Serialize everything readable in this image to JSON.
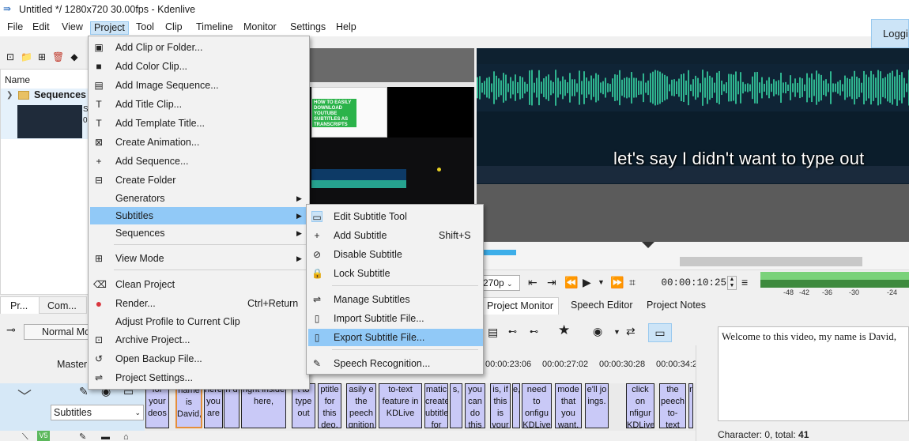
{
  "window": {
    "title": "Untitled */ 1280x720 30.00fps - Kdenlive"
  },
  "menubar": {
    "items": [
      "File",
      "Edit",
      "View",
      "Project",
      "Tool",
      "Clip",
      "Timeline",
      "Monitor",
      "Settings",
      "Help"
    ],
    "login_label": "Loggin"
  },
  "project_menu": {
    "items": [
      {
        "label": "Add Clip or Folder...",
        "icon": "add-clip-icon"
      },
      {
        "label": "Add Color Clip...",
        "icon": "color-clip-icon"
      },
      {
        "label": "Add Image Sequence...",
        "icon": "image-sequence-icon"
      },
      {
        "label": "Add Title Clip...",
        "icon": "title-clip-icon"
      },
      {
        "label": "Add Template Title...",
        "icon": "template-title-icon"
      },
      {
        "label": "Create Animation...",
        "icon": "animation-icon"
      },
      {
        "label": "Add Sequence...",
        "icon": "plus-icon"
      },
      {
        "label": "Create Folder",
        "icon": "folder-icon"
      },
      {
        "label": "Generators",
        "icon": ""
      },
      {
        "label": "Subtitles",
        "icon": ""
      },
      {
        "label": "Sequences",
        "icon": ""
      },
      {
        "label": "View Mode",
        "icon": "view-mode-icon"
      },
      {
        "label": "Clean Project",
        "icon": "clean-icon"
      },
      {
        "label": "Render...",
        "icon": "render-icon",
        "shortcut": "Ctrl+Return"
      },
      {
        "label": "Adjust Profile to Current Clip",
        "icon": ""
      },
      {
        "label": "Archive Project...",
        "icon": "archive-icon"
      },
      {
        "label": "Open Backup File...",
        "icon": "backup-icon"
      },
      {
        "label": "Project Settings...",
        "icon": "settings-icon"
      }
    ]
  },
  "subtitles_menu": {
    "items": [
      {
        "label": "Edit Subtitle Tool",
        "icon": "subtitle-tool-icon"
      },
      {
        "label": "Add Subtitle",
        "icon": "plus-icon",
        "shortcut": "Shift+S"
      },
      {
        "label": "Disable Subtitle",
        "icon": "disable-icon"
      },
      {
        "label": "Lock Subtitle",
        "icon": "lock-icon"
      },
      {
        "label": "Manage Subtitles",
        "icon": "manage-icon"
      },
      {
        "label": "Import Subtitle File...",
        "icon": "import-icon"
      },
      {
        "label": "Export Subtitle File...",
        "icon": "export-icon"
      },
      {
        "label": "Speech Recognition...",
        "icon": "speech-icon"
      }
    ]
  },
  "bin": {
    "column_name": "Name",
    "folder_label": "Sequences",
    "thumb_label_1": "S",
    "thumb_label_2": "0",
    "tabs": [
      "Pr...",
      "Com..."
    ]
  },
  "clip_monitor": {
    "thumb_text": "HOW TO EASILY DOWNLOAD YOUTUBE SUBTITLES AS TRANSCRIPTS"
  },
  "project_monitor": {
    "subtitle_overlay": "let's say I didn't want to type out",
    "resolution": "270p",
    "timecode": "00:00:10:25",
    "vu_labels": [
      "-48",
      "-42",
      "-36",
      "-30",
      "-24"
    ]
  },
  "tabs": [
    "Project Monitor",
    "Speech Editor",
    "Project Notes"
  ],
  "speech_editor": {
    "text": "Welcome to this video, my name is David,",
    "char_label": "Character: 0, total: ",
    "char_total": "41"
  },
  "timeline": {
    "edit_mode": "Normal Mo",
    "master_label": "Master",
    "track_select": "Subtitles",
    "v1_badge": "V5",
    "ruler_ticks": [
      "00:00:23:06",
      "00:00:27:02",
      "00:00:30:28",
      "00:00:34:24"
    ],
    "subtitle_clips": [
      "for your deos",
      "name is David,",
      "here you are",
      "n d",
      "right inside here,",
      "t to type out",
      "ptitle for this deo,",
      "asily e the peech gnition",
      "to-text feature in KDLive",
      "matic create ubtitle for",
      "s,",
      "you can do this",
      "is, if this is your",
      "e,",
      "need to onfigu KDLive",
      "mode that you want.",
      "e'll jo ings.",
      "click on nfigur KDLive",
      "the peech to- text",
      "r"
    ]
  }
}
